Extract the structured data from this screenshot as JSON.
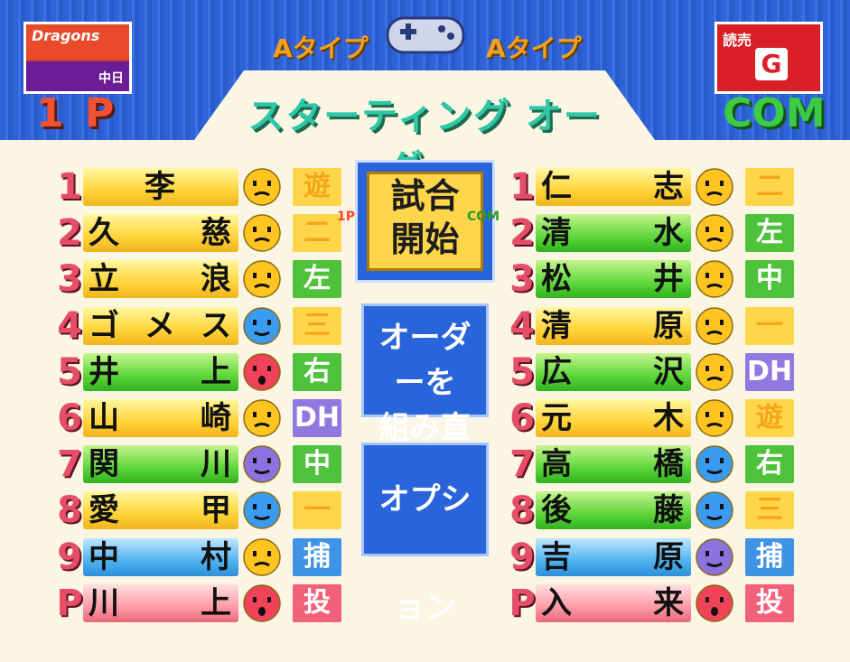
{
  "header": {
    "title": "スターティング オーダー",
    "left_control": "1 P",
    "right_control": "COM",
    "left_type": "Aタイプ",
    "right_type": "Aタイプ",
    "left_team_logo": "Dragons",
    "left_team_sub": "中日",
    "right_team_name": "読売",
    "right_team_mark": "G"
  },
  "buttons": {
    "start_line1": "試合",
    "start_line2": "開始",
    "start_tag_left": "1P",
    "start_tag_right": "COM",
    "reorder_line1": "オーダーを",
    "reorder_line2": "組み直す",
    "options": "オプション"
  },
  "left_lineup": [
    {
      "num": "1",
      "name": [
        "李"
      ],
      "bar": "yellow",
      "face": "neutral",
      "pos": "遊",
      "pos_color": "yellow"
    },
    {
      "num": "2",
      "name": [
        "久",
        "慈"
      ],
      "bar": "yellow",
      "face": "neutral",
      "pos": "二",
      "pos_color": "yellow"
    },
    {
      "num": "3",
      "name": [
        "立",
        "浪"
      ],
      "bar": "yellow",
      "face": "neutral",
      "pos": "左",
      "pos_color": "green"
    },
    {
      "num": "4",
      "name": [
        "ゴ",
        "メ",
        "ス"
      ],
      "bar": "yellow",
      "face": "blue",
      "pos": "三",
      "pos_color": "yellow"
    },
    {
      "num": "5",
      "name": [
        "井",
        "上"
      ],
      "bar": "green",
      "face": "red",
      "pos": "右",
      "pos_color": "green"
    },
    {
      "num": "6",
      "name": [
        "山",
        "崎"
      ],
      "bar": "yellow",
      "face": "neutral",
      "pos": "DH",
      "pos_color": "purple"
    },
    {
      "num": "7",
      "name": [
        "関",
        "川"
      ],
      "bar": "green",
      "face": "purple",
      "pos": "中",
      "pos_color": "green"
    },
    {
      "num": "8",
      "name": [
        "愛",
        "甲"
      ],
      "bar": "yellow",
      "face": "blue",
      "pos": "一",
      "pos_color": "yellow"
    },
    {
      "num": "9",
      "name": [
        "中",
        "村"
      ],
      "bar": "blue",
      "face": "neutral",
      "pos": "捕",
      "pos_color": "blue"
    },
    {
      "num": "P",
      "name": [
        "川",
        "上"
      ],
      "bar": "pink",
      "face": "red",
      "pos": "投",
      "pos_color": "red"
    }
  ],
  "right_lineup": [
    {
      "num": "1",
      "name": [
        "仁",
        "志"
      ],
      "bar": "yellow",
      "face": "neutral",
      "pos": "二",
      "pos_color": "yellow"
    },
    {
      "num": "2",
      "name": [
        "清",
        "水"
      ],
      "bar": "green",
      "face": "neutral",
      "pos": "左",
      "pos_color": "green"
    },
    {
      "num": "3",
      "name": [
        "松",
        "井"
      ],
      "bar": "green",
      "face": "neutral",
      "pos": "中",
      "pos_color": "green"
    },
    {
      "num": "4",
      "name": [
        "清",
        "原"
      ],
      "bar": "yellow",
      "face": "neutral",
      "pos": "一",
      "pos_color": "yellow"
    },
    {
      "num": "5",
      "name": [
        "広",
        "沢"
      ],
      "bar": "green",
      "face": "neutral",
      "pos": "DH",
      "pos_color": "purple"
    },
    {
      "num": "6",
      "name": [
        "元",
        "木"
      ],
      "bar": "yellow",
      "face": "neutral",
      "pos": "遊",
      "pos_color": "yellow"
    },
    {
      "num": "7",
      "name": [
        "高",
        "橋"
      ],
      "bar": "green",
      "face": "blue",
      "pos": "右",
      "pos_color": "green"
    },
    {
      "num": "8",
      "name": [
        "後",
        "藤"
      ],
      "bar": "green",
      "face": "blue",
      "pos": "三",
      "pos_color": "yellow"
    },
    {
      "num": "9",
      "name": [
        "吉",
        "原"
      ],
      "bar": "blue",
      "face": "purple",
      "pos": "捕",
      "pos_color": "blue"
    },
    {
      "num": "P",
      "name": [
        "入",
        "来"
      ],
      "bar": "pink",
      "face": "red",
      "pos": "投",
      "pos_color": "red"
    }
  ],
  "colors": {
    "neutral": "#ffc41f",
    "blue": "#3a9bf0",
    "red": "#f0435a",
    "purple": "#8a72df"
  }
}
